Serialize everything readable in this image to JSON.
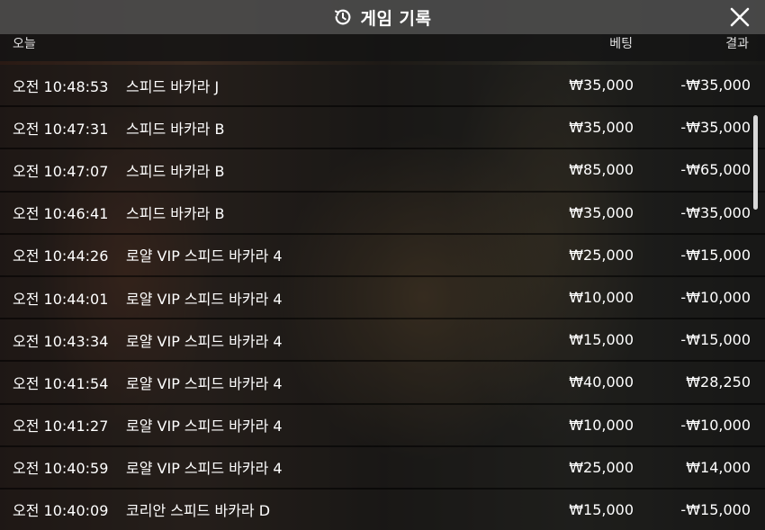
{
  "header": {
    "title": "게임 기록",
    "icon": "history-icon",
    "close_icon": "close-icon"
  },
  "columns": {
    "date": "오늘",
    "bet": "베팅",
    "result": "결과"
  },
  "rows": [
    {
      "time": "오전 10:48:53",
      "game": "스피드 바카라 J",
      "bet": "₩35,000",
      "result": "-₩35,000"
    },
    {
      "time": "오전 10:47:31",
      "game": "스피드 바카라 B",
      "bet": "₩35,000",
      "result": "-₩35,000"
    },
    {
      "time": "오전 10:47:07",
      "game": "스피드 바카라 B",
      "bet": "₩85,000",
      "result": "-₩65,000"
    },
    {
      "time": "오전 10:46:41",
      "game": "스피드 바카라 B",
      "bet": "₩35,000",
      "result": "-₩35,000"
    },
    {
      "time": "오전 10:44:26",
      "game": "로얄 VIP 스피드 바카라 4",
      "bet": "₩25,000",
      "result": "-₩15,000"
    },
    {
      "time": "오전 10:44:01",
      "game": "로얄 VIP 스피드 바카라 4",
      "bet": "₩10,000",
      "result": "-₩10,000"
    },
    {
      "time": "오전 10:43:34",
      "game": "로얄 VIP 스피드 바카라 4",
      "bet": "₩15,000",
      "result": "-₩15,000"
    },
    {
      "time": "오전 10:41:54",
      "game": "로얄 VIP 스피드 바카라 4",
      "bet": "₩40,000",
      "result": "₩28,250"
    },
    {
      "time": "오전 10:41:27",
      "game": "로얄 VIP 스피드 바카라 4",
      "bet": "₩10,000",
      "result": "-₩10,000"
    },
    {
      "time": "오전 10:40:59",
      "game": "로얄 VIP 스피드 바카라 4",
      "bet": "₩25,000",
      "result": "₩14,000"
    },
    {
      "time": "오전 10:40:09",
      "game": "코리안 스피드 바카라 D",
      "bet": "₩15,000",
      "result": "-₩15,000"
    }
  ]
}
